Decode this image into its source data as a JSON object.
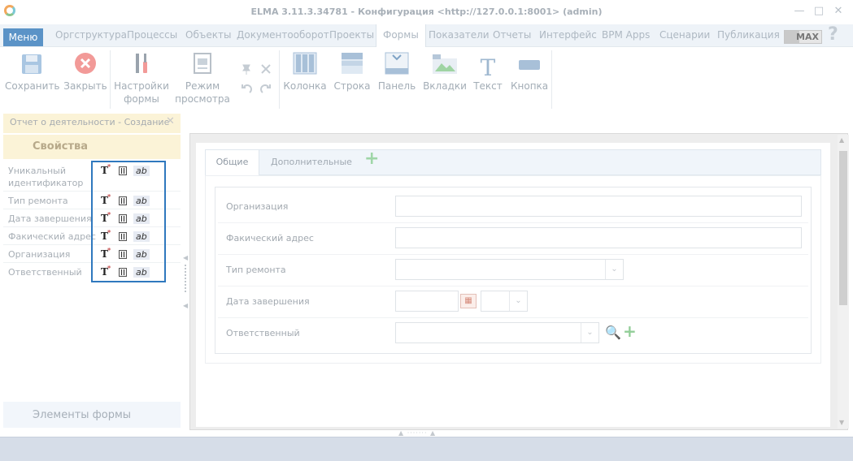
{
  "window": {
    "title": "ELMA 3.11.3.34781 - Конфигурация <http://127.0.0.1:8001> (admin)",
    "controls": {
      "minimize": "—",
      "maximize": "□",
      "close": "✕"
    }
  },
  "menubar": {
    "menu_button": "Меню",
    "items": [
      "Оргструктура",
      "Процессы",
      "Объекты",
      "Документооборот",
      "Проекты",
      "Формы",
      "Показатели",
      "Отчеты",
      "Интерфейс",
      "BPM Apps",
      "Сценарии",
      "Публикация"
    ],
    "active_item": "Формы",
    "max_badge": "MAX",
    "help": "?"
  },
  "toolbar": {
    "save": "Сохранить",
    "close": "Закрыть",
    "form_settings_1": "Настройки",
    "form_settings_2": "формы",
    "view_mode_1": "Режим",
    "view_mode_2": "просмотра",
    "column": "Колонка",
    "row": "Строка",
    "panel": "Панель",
    "tabs": "Вкладки",
    "text": "Текст",
    "button": "Кнопка",
    "text_glyph": "T"
  },
  "document_tab": {
    "label": "Отчет о деятельности - Создание",
    "close": "✕"
  },
  "properties": {
    "header": "Свойства",
    "icons": {
      "type": "T",
      "required_mark": "*",
      "ab": "ab"
    },
    "rows": [
      {
        "label_1": "Уникальный",
        "label_2": "идентификатор"
      },
      {
        "label_1": "Тип ремонта"
      },
      {
        "label_1": "Дата завершения"
      },
      {
        "label_1": "Факический адрес"
      },
      {
        "label_1": "Организация"
      },
      {
        "label_1": "Ответственный"
      }
    ]
  },
  "elements_header": "Элементы формы",
  "form": {
    "tabs": [
      "Общие",
      "Дополнительные"
    ],
    "active_tab": "Общие",
    "add_tab": "+",
    "fields": {
      "organization": "Организация",
      "address": "Факический адрес",
      "repair_type": "Тип ремонта",
      "completion_date": "Дата завершения",
      "responsible": "Ответственный"
    },
    "glyphs": {
      "dropdown": "⌄",
      "search": "🔍",
      "add": "+",
      "calendar": "▦"
    }
  },
  "colors": {
    "accent": "#5b93c7",
    "highlight": "#2f78be",
    "panel_header": "#fbf3d7",
    "status_bar": "#d6dde8"
  }
}
